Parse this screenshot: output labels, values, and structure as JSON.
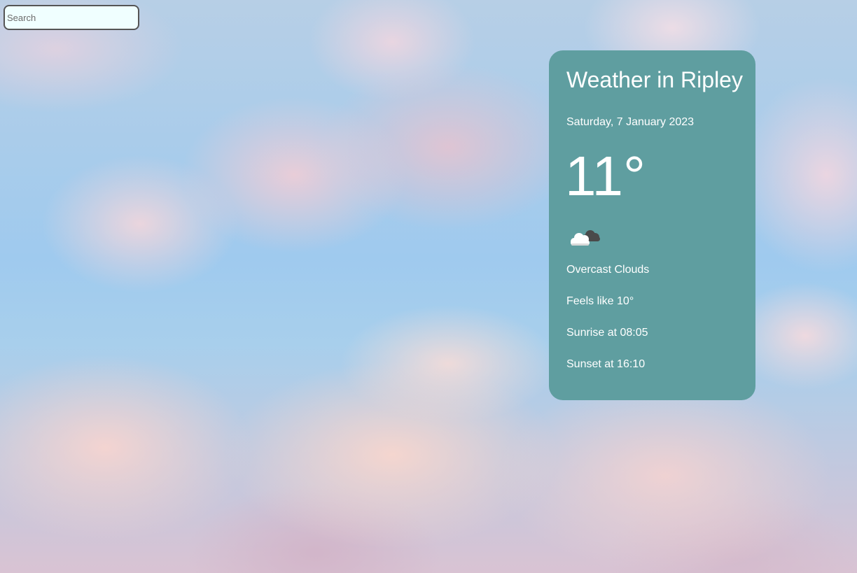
{
  "search": {
    "placeholder": "Search",
    "value": ""
  },
  "weather": {
    "title": "Weather in Ripley",
    "date": "Saturday, 7 January 2023",
    "temperature": "11°",
    "icon": "overcast-clouds-icon",
    "description": "Overcast Clouds",
    "feels_like": "Feels like 10°",
    "sunrise": "Sunrise at 08:05",
    "sunset": "Sunset at 16:10"
  },
  "colors": {
    "card_background": "#5f9ea0",
    "card_text": "#ffffff",
    "search_background": "#f0ffff"
  }
}
